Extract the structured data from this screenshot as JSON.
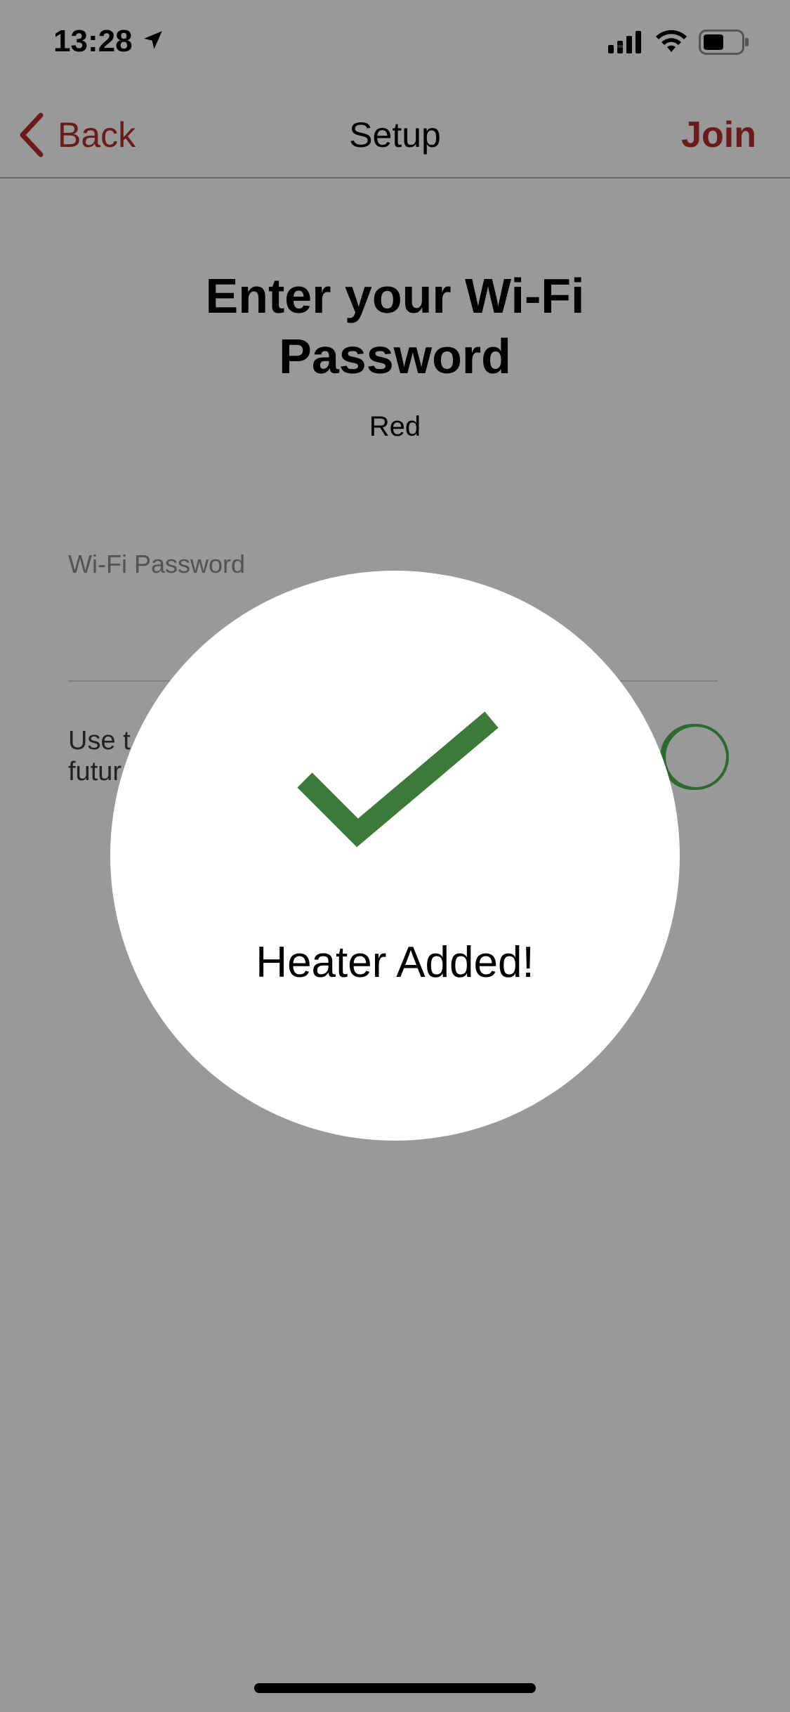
{
  "status_bar": {
    "time": "13:28",
    "location_icon": "location-arrow-icon",
    "signal_icon": "cellular-signal-icon",
    "wifi_icon": "wifi-icon",
    "battery_icon": "battery-icon"
  },
  "nav": {
    "back_label": "Back",
    "title": "Setup",
    "join_label": "Join",
    "accent_color": "#b32d2e"
  },
  "content": {
    "heading": "Enter your Wi-Fi Password",
    "network_name": "Red",
    "password_label": "Wi-Fi Password",
    "password_value": "",
    "save_text": "Use t\nfutur",
    "toggle_on": true,
    "toggle_color": "#4caf50"
  },
  "modal": {
    "icon": "checkmark-icon",
    "icon_color": "#3d7a3a",
    "message": "Heater Added!"
  }
}
